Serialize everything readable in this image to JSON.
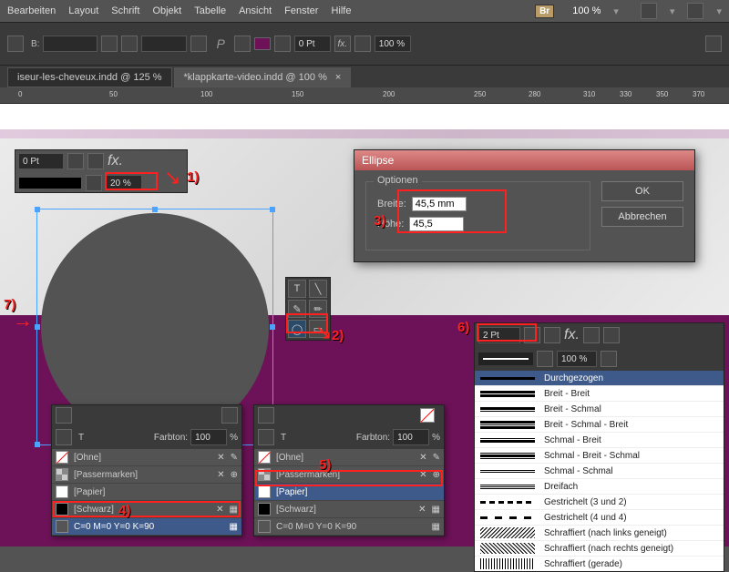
{
  "menu": {
    "items": [
      "Bearbeiten",
      "Layout",
      "Schrift",
      "Objekt",
      "Tabelle",
      "Ansicht",
      "Fenster",
      "Hilfe"
    ],
    "br": "Br",
    "zoom": "100 %"
  },
  "tabs": {
    "t1": "iseur-les-cheveux.indd @ 125 %",
    "t2": "*klappkarte-video.indd @ 100 %"
  },
  "ruler": [
    "0",
    "50",
    "100",
    "150",
    "200",
    "250",
    "280",
    "310",
    "330",
    "350",
    "370"
  ],
  "panel1": {
    "pt": "0 Pt",
    "opacity": "20 %"
  },
  "marks": {
    "m1": "1)",
    "m2": "2)",
    "m3": "3)",
    "m4": "4)",
    "m5": "5)",
    "m6": "6)",
    "m7": "7)"
  },
  "dialog": {
    "title": "Ellipse",
    "opts": "Optionen",
    "breite_l": "Breite:",
    "breite_v": "45,5 mm",
    "hohe_l": "Höhe:",
    "hohe_v": "45,5",
    "ok": "OK",
    "cancel": "Abbrechen"
  },
  "swatches": {
    "farbton": "Farbton:",
    "fv": "100",
    "ohne": "[Ohne]",
    "passer": "[Passermarken]",
    "papier": "[Papier]",
    "schwarz": "[Schwarz]",
    "cmyk": "C=0 M=0 Y=0 K=90"
  },
  "stroke": {
    "pt": "2 Pt",
    "pct": "100 %",
    "types": [
      "Durchgezogen",
      "Breit - Breit",
      "Breit - Schmal",
      "Breit - Schmal - Breit",
      "Schmal - Breit",
      "Schmal - Breit - Schmal",
      "Schmal - Schmal",
      "Dreifach",
      "Gestrichelt (3 und 2)",
      "Gestrichelt (4 und 4)",
      "Schraffiert (nach links geneigt)",
      "Schraffiert (nach rechts geneigt)",
      "Schraffiert (gerade)"
    ]
  }
}
